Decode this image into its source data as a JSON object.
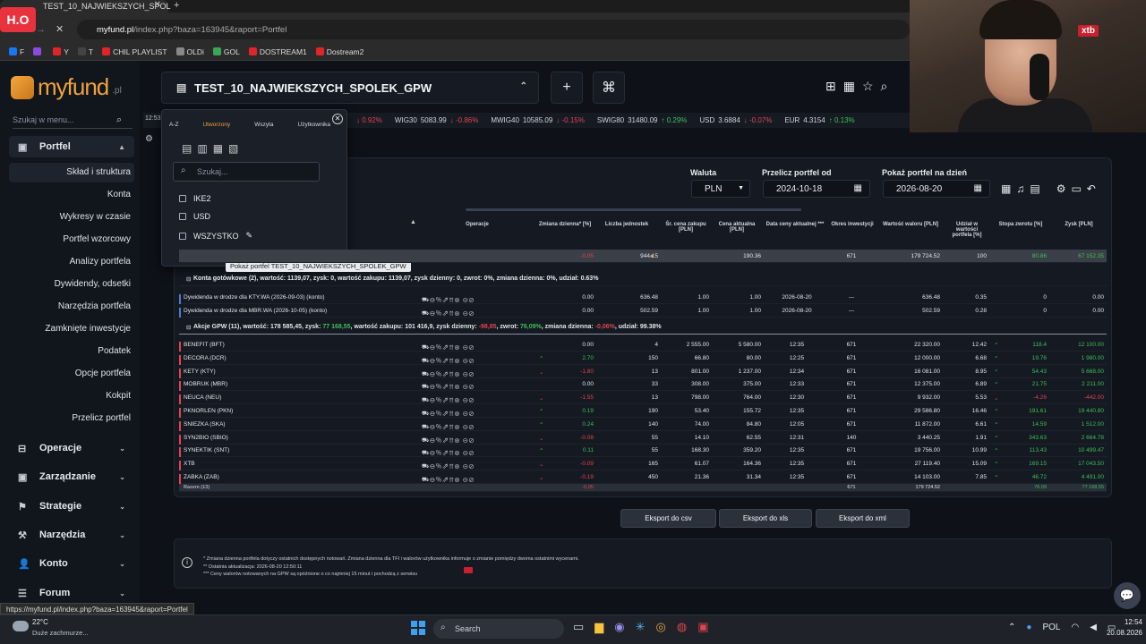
{
  "browser": {
    "tab_title": "TEST_10_NAJWIEKSZYCH_SPOL",
    "address": "myfund.pl/index.php?baza=163945&raport=Portfel",
    "address_host": "myfund.pl",
    "address_path": "/index.php?baza=163945&raport=Portfel",
    "bookmarks": [
      {
        "label": "F",
        "color": "#1877f2"
      },
      {
        "label": "",
        "color": "#8a4be0"
      },
      {
        "label": "Y",
        "color": "#e0242a"
      },
      {
        "label": "T",
        "color": "#444444"
      },
      {
        "label": "CHIL PLAYLIST",
        "color": "#e0242a"
      },
      {
        "label": "OLDi",
        "color": "#888888"
      },
      {
        "label": "GOL",
        "color": "#3aa657"
      },
      {
        "label": "DOSTREAM1",
        "color": "#e0242a"
      },
      {
        "label": "Dostream2",
        "color": "#e0242a"
      }
    ],
    "status_url": "https://myfund.pl/index.php?baza=163945&raport=Portfel"
  },
  "sidebar": {
    "logo": "myfund",
    "logo_suffix": ".pl",
    "search_placeholder": "Szukaj w menu...",
    "portfel": "Portfel",
    "sub_items": [
      "Skład i struktura",
      "Konta",
      "Wykresy w czasie",
      "Portfel wzorcowy",
      "Analizy portfela",
      "Dywidendy, odsetki",
      "Narzędzia portfela",
      "Zamknięte inwestycje",
      "Podatek",
      "Opcje portfela",
      "Kokpit",
      "Przelicz portfel"
    ],
    "sections": [
      "Operacje",
      "Zarządzanie",
      "Strategie",
      "Narzędzia",
      "Konto",
      "Forum"
    ]
  },
  "header": {
    "portfolio_name": "TEST_10_NAJWIEKSZYCH_SPOLEK_GPW",
    "time": "12:53"
  },
  "ticker": [
    {
      "label": "",
      "value": "",
      "change": "0.92%",
      "dir": "down"
    },
    {
      "label": "WIG30",
      "value": "5083.99",
      "change": "-0.86%",
      "dir": "down"
    },
    {
      "label": "MWIG40",
      "value": "10585.09",
      "change": "-0.15%",
      "dir": "down"
    },
    {
      "label": "SWIG80",
      "value": "31480.09",
      "change": "0.29%",
      "dir": "up"
    },
    {
      "label": "USD",
      "value": "3.6884",
      "change": "-0.07%",
      "dir": "down"
    },
    {
      "label": "EUR",
      "value": "4.3154",
      "change": "0.13%",
      "dir": "up"
    }
  ],
  "controls": {
    "waluta_label": "Waluta",
    "waluta_value": "PLN",
    "przelicz_label": "Przelicz portfel od",
    "przelicz_value": "2024-10-18",
    "pokaz_label": "Pokaż portfel na dzień",
    "pokaz_value": "2026-08-20"
  },
  "dropdown": {
    "tabs": [
      "A-Z",
      "Utworzony",
      "Wszyta",
      "Użytkownika"
    ],
    "search_placeholder": "Szukaj...",
    "items": [
      "IKE2",
      "USD",
      "WSZYSTKO",
      "TEST_10_NAJWIEKSZYCH_SPO..."
    ],
    "tooltip": "Pokaż portfel TEST_10_NAJWIEKSZYCH_SPOLEK_GPW"
  },
  "table": {
    "headers": {
      "ops": "Operacje",
      "chg": "Zmiana dzienna* [%]",
      "qty": "Liczba jednostek",
      "avg": "Śr. cena zakupu [PLN]",
      "cur": "Cena aktualna [PLN]",
      "date": "Data ceny aktualnej ***",
      "per": "Okres inwestycji",
      "val": "Wartość waloru [PLN]",
      "sh": "Udział w wartości portfela [%]",
      "ret": "Stopa zwrotu [%]",
      "prof": "Zysk [PLN]"
    },
    "summary": {
      "chg": "-0.05",
      "qty": "944.15",
      "cur": "190.36",
      "per": "671",
      "val": "179 724.52",
      "sh": "100",
      "ret": "80.86",
      "prof": "67 152.35"
    },
    "konta_header": "Konta gotówkowe (2), wartość: 1139,07, zysk: 0, wartość zakupu: 1139,07, zysk dzienny: 0, zwrot: 0%, zmiana dzienna: 0%, udział: 0.63%",
    "konta": [
      {
        "name": "Dywidenda w drodze dla KTY.WA (2026-09-03) (konto)",
        "chg": "0.00",
        "qty": "636.48",
        "avg": "1.00",
        "cur": "1.00",
        "date": "2026-08-20",
        "per": "---",
        "val": "636.48",
        "sh": "0.35",
        "ret": "0",
        "prof": "0.00"
      },
      {
        "name": "Dywidenda w drodze dla MBR.WA (2026-10-05) (konto)",
        "chg": "0.00",
        "qty": "502.59",
        "avg": "1.00",
        "cur": "1.00",
        "date": "2026-08-20",
        "per": "---",
        "val": "502.59",
        "sh": "0.28",
        "ret": "0",
        "prof": "0.00"
      }
    ],
    "akcje_prefix": "Akcje GPW (11), wartość: 178 585,45, zysk: ",
    "akcje_profit": "77 168,55",
    "akcje_mid": ", wartość zakupu: 101 416,9, zysk dzienny: ",
    "akcje_daily": "-98,85",
    "akcje_zwrot_label": ", zwrot: ",
    "akcje_zwrot": "76,09%",
    "akcje_zmiana_label": ", zmiana dzienna: ",
    "akcje_zmiana": "-0,06%",
    "akcje_suffix": ", udział: 99.38%",
    "ops_icons": "⛟⊖％⇗⇈⊛ ⊝⊘",
    "stocks": [
      {
        "name": "BENEFIT (BFT)",
        "color": "#e0444e",
        "chg": "0.00",
        "dir": "",
        "qty": "4",
        "avg": "2 555.00",
        "cur": "5 580.00",
        "date": "12:35",
        "per": "671",
        "val": "22 320.00",
        "sh": "12.42",
        "ret": "118.4",
        "prof": "12 100.00"
      },
      {
        "name": "DECORA (DCR)",
        "color": "#e0444e",
        "chg": "2.70",
        "dir": "up",
        "qty": "150",
        "avg": "66.80",
        "cur": "80.00",
        "date": "12:25",
        "per": "671",
        "val": "12 000.00",
        "sh": "6.68",
        "ret": "19.76",
        "prof": "1 980.00"
      },
      {
        "name": "KETY (KTY)",
        "color": "#e0444e",
        "chg": "-1.80",
        "dir": "down",
        "qty": "13",
        "avg": "801.00",
        "cur": "1 237.00",
        "date": "12:34",
        "per": "671",
        "val": "16 081.00",
        "sh": "8.95",
        "ret": "54.43",
        "prof": "5 668.00"
      },
      {
        "name": "MOBRUK (MBR)",
        "color": "#e0444e",
        "chg": "0.00",
        "dir": "",
        "qty": "33",
        "avg": "308.00",
        "cur": "375.00",
        "date": "12:33",
        "per": "671",
        "val": "12 375.00",
        "sh": "6.89",
        "ret": "21.75",
        "prof": "2 211.00"
      },
      {
        "name": "NEUCA (NEU)",
        "color": "#e0444e",
        "chg": "-1.55",
        "dir": "down",
        "qty": "13",
        "avg": "798.00",
        "cur": "764.00",
        "date": "12:30",
        "per": "671",
        "val": "9 932.00",
        "sh": "5.53",
        "ret": "-4.26",
        "prof": "-442.00"
      },
      {
        "name": "PKNORLEN (PKN)",
        "color": "#e0444e",
        "chg": "0.19",
        "dir": "up",
        "qty": "190",
        "avg": "53.40",
        "cur": "155.72",
        "date": "12:35",
        "per": "671",
        "val": "29 586.80",
        "sh": "16.46",
        "ret": "191.61",
        "prof": "19 440.80"
      },
      {
        "name": "SNIEZKA (SKA)",
        "color": "#e0444e",
        "chg": "0.24",
        "dir": "up",
        "qty": "140",
        "avg": "74.00",
        "cur": "84.80",
        "date": "12:05",
        "per": "671",
        "val": "11 872.00",
        "sh": "6.61",
        "ret": "14.59",
        "prof": "1 512.00"
      },
      {
        "name": "SYN2BIO (SBIO)",
        "color": "#e0444e",
        "chg": "-0.08",
        "dir": "down",
        "qty": "55",
        "avg": "14.10",
        "cur": "62.55",
        "date": "12:31",
        "per": "140",
        "val": "3 440.25",
        "sh": "1.91",
        "ret": "343.63",
        "prof": "2 664.78"
      },
      {
        "name": "SYNEKTIK (SNT)",
        "color": "#e0444e",
        "chg": "0.11",
        "dir": "up",
        "qty": "55",
        "avg": "168.30",
        "cur": "359.20",
        "date": "12:35",
        "per": "671",
        "val": "19 756.00",
        "sh": "10.99",
        "ret": "113.43",
        "prof": "10 499.47"
      },
      {
        "name": "XTB",
        "color": "#e0444e",
        "chg": "-0.09",
        "dir": "down",
        "qty": "165",
        "avg": "61.07",
        "cur": "164.36",
        "date": "12:35",
        "per": "671",
        "val": "27 119.40",
        "sh": "15.09",
        "ret": "169.15",
        "prof": "17 043.50"
      },
      {
        "name": "ZABKA (ZAB)",
        "color": "#e0444e",
        "chg": "-0.19",
        "dir": "down",
        "qty": "450",
        "avg": "21.36",
        "cur": "31.34",
        "date": "12:35",
        "per": "671",
        "val": "14 103.00",
        "sh": "7.85",
        "ret": "46.72",
        "prof": "4 491.00"
      }
    ],
    "total": {
      "name": "Razem (13)",
      "chg": "-0.05",
      "per": "671",
      "val": "179 724.52",
      "ret": "76.09",
      "prof": "77 168.55"
    }
  },
  "export": {
    "csv": "Eksport do csv",
    "xls": "Eksport do xls",
    "xml": "Eksport do xml"
  },
  "notes": [
    "* Zmiana dzienna portfela dotyczy ostatnich dostępnych notowań. Zmiana dzienna dla TFI i walorów użytkownika informuje o zmianie pomiędzy dwoma ostatnimi wycenami.",
    "** Ostatnia aktualizacja: 2026-08-20 12:50:11",
    "*** Ceny walorów notowanych na GPW są opóźnione o co najmniej 15 minut i pochodzą z serwisu"
  ],
  "webcam": {
    "brand": "xtb"
  },
  "corner_logo": "H.O",
  "taskbar": {
    "weather_temp": "22°C",
    "weather_desc": "Duże zachmurze...",
    "search": "Search",
    "lang": "POL",
    "time": "12:54",
    "date": "20.08.2026"
  },
  "colors": {
    "accent": "#f0a23c",
    "up": "#3fbf5a",
    "down": "#e0444e"
  }
}
